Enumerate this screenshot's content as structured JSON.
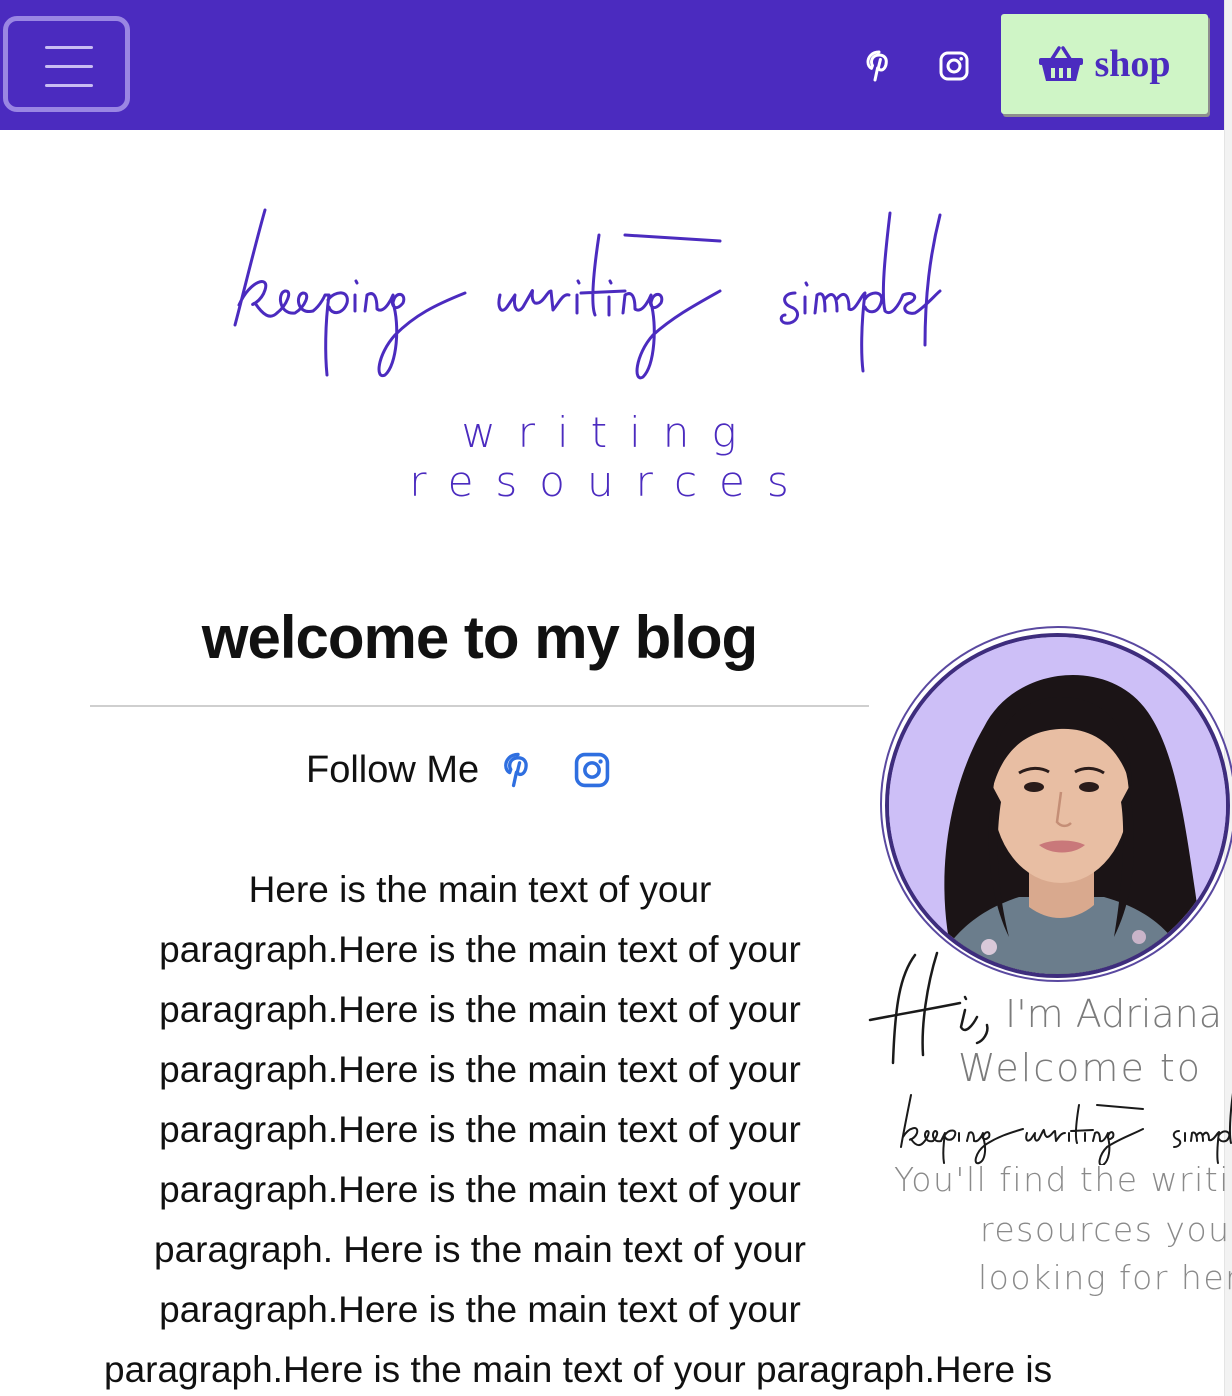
{
  "nav": {
    "shop_label": "shop",
    "social": [
      "pinterest-icon",
      "instagram-icon"
    ]
  },
  "logo": {
    "script": "keeping writing simple",
    "subtitle": "writing resources"
  },
  "main": {
    "title": "welcome to my blog",
    "follow_label": "Follow Me",
    "paragraph_lines": [
      "Here is the main text of your",
      "paragraph.Here is the main text of your",
      "paragraph.Here is the main text of your",
      "paragraph.Here is the main text of your",
      "paragraph.Here is the main text of your",
      "paragraph.Here is the main text of your",
      "paragraph. Here is the main text of your",
      "paragraph.Here is the main text of your",
      "paragraph.Here is the main text of your paragraph.Here is"
    ]
  },
  "sidebar": {
    "hi": "Hi,",
    "greeting": "I'm Adriana",
    "welcome": "Welcome to",
    "brand_script": "keeping writing simple",
    "text_lines": [
      "You'll find the writin",
      "resources you'r",
      "looking for here"
    ]
  },
  "colors": {
    "brand_purple": "#4b2bbf",
    "shop_green": "#cff5c6",
    "link_blue": "#2f6fe0",
    "avatar_bg": "#cdbff7"
  }
}
